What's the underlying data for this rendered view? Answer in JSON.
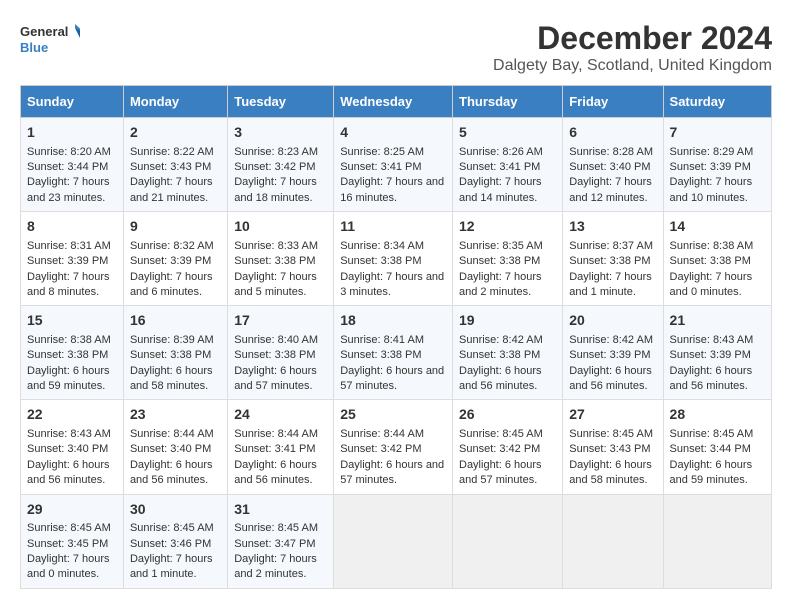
{
  "logo": {
    "general": "General",
    "blue": "Blue"
  },
  "title": "December 2024",
  "subtitle": "Dalgety Bay, Scotland, United Kingdom",
  "days_of_week": [
    "Sunday",
    "Monday",
    "Tuesday",
    "Wednesday",
    "Thursday",
    "Friday",
    "Saturday"
  ],
  "weeks": [
    [
      {
        "day": "1",
        "sunrise": "Sunrise: 8:20 AM",
        "sunset": "Sunset: 3:44 PM",
        "daylight": "Daylight: 7 hours and 23 minutes."
      },
      {
        "day": "2",
        "sunrise": "Sunrise: 8:22 AM",
        "sunset": "Sunset: 3:43 PM",
        "daylight": "Daylight: 7 hours and 21 minutes."
      },
      {
        "day": "3",
        "sunrise": "Sunrise: 8:23 AM",
        "sunset": "Sunset: 3:42 PM",
        "daylight": "Daylight: 7 hours and 18 minutes."
      },
      {
        "day": "4",
        "sunrise": "Sunrise: 8:25 AM",
        "sunset": "Sunset: 3:41 PM",
        "daylight": "Daylight: 7 hours and 16 minutes."
      },
      {
        "day": "5",
        "sunrise": "Sunrise: 8:26 AM",
        "sunset": "Sunset: 3:41 PM",
        "daylight": "Daylight: 7 hours and 14 minutes."
      },
      {
        "day": "6",
        "sunrise": "Sunrise: 8:28 AM",
        "sunset": "Sunset: 3:40 PM",
        "daylight": "Daylight: 7 hours and 12 minutes."
      },
      {
        "day": "7",
        "sunrise": "Sunrise: 8:29 AM",
        "sunset": "Sunset: 3:39 PM",
        "daylight": "Daylight: 7 hours and 10 minutes."
      }
    ],
    [
      {
        "day": "8",
        "sunrise": "Sunrise: 8:31 AM",
        "sunset": "Sunset: 3:39 PM",
        "daylight": "Daylight: 7 hours and 8 minutes."
      },
      {
        "day": "9",
        "sunrise": "Sunrise: 8:32 AM",
        "sunset": "Sunset: 3:39 PM",
        "daylight": "Daylight: 7 hours and 6 minutes."
      },
      {
        "day": "10",
        "sunrise": "Sunrise: 8:33 AM",
        "sunset": "Sunset: 3:38 PM",
        "daylight": "Daylight: 7 hours and 5 minutes."
      },
      {
        "day": "11",
        "sunrise": "Sunrise: 8:34 AM",
        "sunset": "Sunset: 3:38 PM",
        "daylight": "Daylight: 7 hours and 3 minutes."
      },
      {
        "day": "12",
        "sunrise": "Sunrise: 8:35 AM",
        "sunset": "Sunset: 3:38 PM",
        "daylight": "Daylight: 7 hours and 2 minutes."
      },
      {
        "day": "13",
        "sunrise": "Sunrise: 8:37 AM",
        "sunset": "Sunset: 3:38 PM",
        "daylight": "Daylight: 7 hours and 1 minute."
      },
      {
        "day": "14",
        "sunrise": "Sunrise: 8:38 AM",
        "sunset": "Sunset: 3:38 PM",
        "daylight": "Daylight: 7 hours and 0 minutes."
      }
    ],
    [
      {
        "day": "15",
        "sunrise": "Sunrise: 8:38 AM",
        "sunset": "Sunset: 3:38 PM",
        "daylight": "Daylight: 6 hours and 59 minutes."
      },
      {
        "day": "16",
        "sunrise": "Sunrise: 8:39 AM",
        "sunset": "Sunset: 3:38 PM",
        "daylight": "Daylight: 6 hours and 58 minutes."
      },
      {
        "day": "17",
        "sunrise": "Sunrise: 8:40 AM",
        "sunset": "Sunset: 3:38 PM",
        "daylight": "Daylight: 6 hours and 57 minutes."
      },
      {
        "day": "18",
        "sunrise": "Sunrise: 8:41 AM",
        "sunset": "Sunset: 3:38 PM",
        "daylight": "Daylight: 6 hours and 57 minutes."
      },
      {
        "day": "19",
        "sunrise": "Sunrise: 8:42 AM",
        "sunset": "Sunset: 3:38 PM",
        "daylight": "Daylight: 6 hours and 56 minutes."
      },
      {
        "day": "20",
        "sunrise": "Sunrise: 8:42 AM",
        "sunset": "Sunset: 3:39 PM",
        "daylight": "Daylight: 6 hours and 56 minutes."
      },
      {
        "day": "21",
        "sunrise": "Sunrise: 8:43 AM",
        "sunset": "Sunset: 3:39 PM",
        "daylight": "Daylight: 6 hours and 56 minutes."
      }
    ],
    [
      {
        "day": "22",
        "sunrise": "Sunrise: 8:43 AM",
        "sunset": "Sunset: 3:40 PM",
        "daylight": "Daylight: 6 hours and 56 minutes."
      },
      {
        "day": "23",
        "sunrise": "Sunrise: 8:44 AM",
        "sunset": "Sunset: 3:40 PM",
        "daylight": "Daylight: 6 hours and 56 minutes."
      },
      {
        "day": "24",
        "sunrise": "Sunrise: 8:44 AM",
        "sunset": "Sunset: 3:41 PM",
        "daylight": "Daylight: 6 hours and 56 minutes."
      },
      {
        "day": "25",
        "sunrise": "Sunrise: 8:44 AM",
        "sunset": "Sunset: 3:42 PM",
        "daylight": "Daylight: 6 hours and 57 minutes."
      },
      {
        "day": "26",
        "sunrise": "Sunrise: 8:45 AM",
        "sunset": "Sunset: 3:42 PM",
        "daylight": "Daylight: 6 hours and 57 minutes."
      },
      {
        "day": "27",
        "sunrise": "Sunrise: 8:45 AM",
        "sunset": "Sunset: 3:43 PM",
        "daylight": "Daylight: 6 hours and 58 minutes."
      },
      {
        "day": "28",
        "sunrise": "Sunrise: 8:45 AM",
        "sunset": "Sunset: 3:44 PM",
        "daylight": "Daylight: 6 hours and 59 minutes."
      }
    ],
    [
      {
        "day": "29",
        "sunrise": "Sunrise: 8:45 AM",
        "sunset": "Sunset: 3:45 PM",
        "daylight": "Daylight: 7 hours and 0 minutes."
      },
      {
        "day": "30",
        "sunrise": "Sunrise: 8:45 AM",
        "sunset": "Sunset: 3:46 PM",
        "daylight": "Daylight: 7 hours and 1 minute."
      },
      {
        "day": "31",
        "sunrise": "Sunrise: 8:45 AM",
        "sunset": "Sunset: 3:47 PM",
        "daylight": "Daylight: 7 hours and 2 minutes."
      },
      null,
      null,
      null,
      null
    ]
  ]
}
